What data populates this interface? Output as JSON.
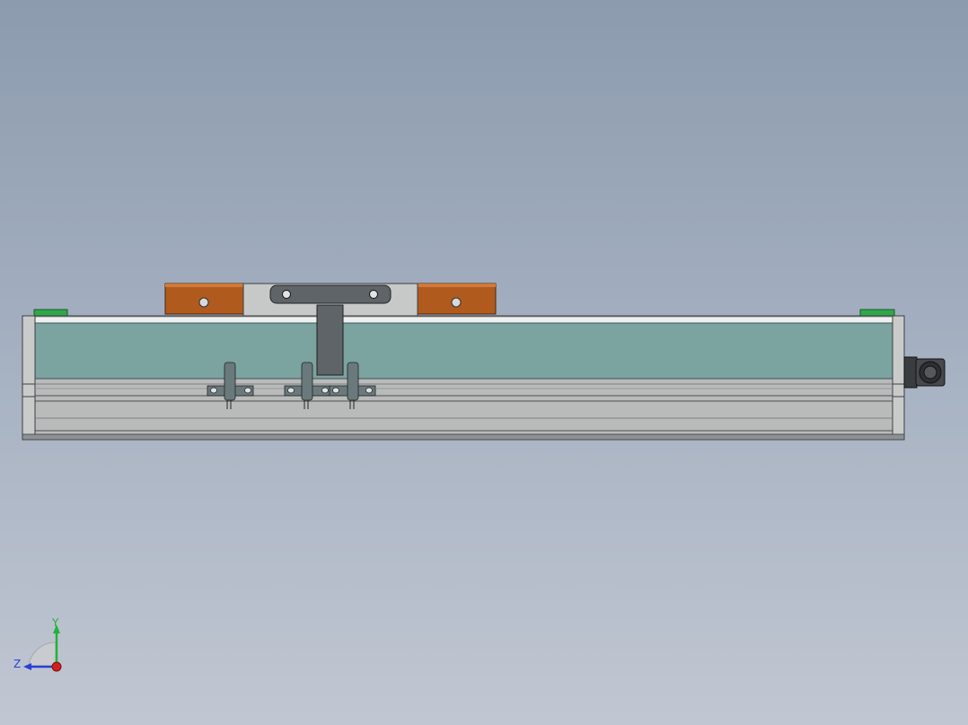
{
  "viewport": {
    "background_top": "#8c9bae",
    "background_bottom": "#c1c7d2"
  },
  "model": {
    "rail_color": "#7ba39f",
    "frame_color": "#b6b8b8",
    "carriage_color": "#b05a1e",
    "accent_color": "#2fa84a"
  },
  "triad": {
    "y_label": "Y",
    "z_label": "Z",
    "y_color": "#21b33a",
    "z_color": "#2a3fd6",
    "x_color": "#d11f1f"
  }
}
